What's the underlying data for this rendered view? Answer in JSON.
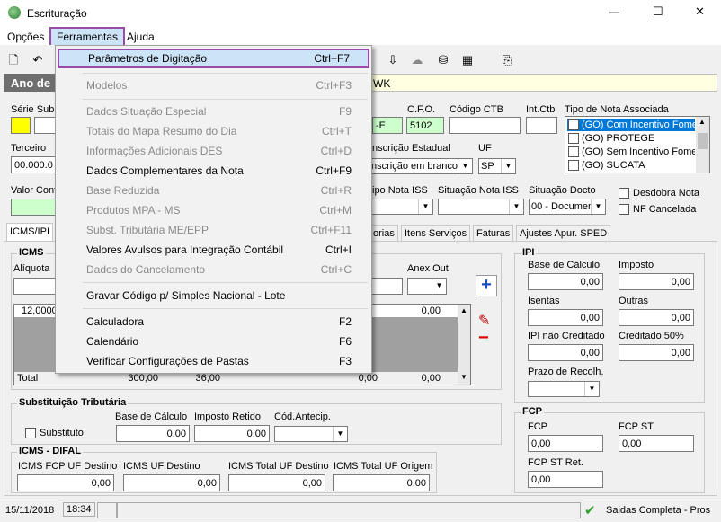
{
  "window": {
    "title": "Escrituração",
    "minimize": "—",
    "maximize": "☐",
    "close": "✕"
  },
  "menubar": {
    "items": [
      "Opções",
      "Ferramentas",
      "Ajuda"
    ]
  },
  "banner": {
    "left": "Ano de",
    "right": "WK"
  },
  "header": {
    "serie_label": "Série Sub",
    "cfo_label": "C.F.O.",
    "cfo_value": "5102",
    "cfo_prefix": "-E",
    "codigo_ctb_label": "Código CTB",
    "int_ctb_label": "Int.Ctb",
    "tipo_nota_label": "Tipo de Nota Associada",
    "tipo_nota_items": [
      "(GO) Com Incentivo Fomer",
      "(GO) PROTEGE",
      "(GO) Sem Incentivo Fomer",
      "(GO) SUCATA"
    ],
    "terceiro_label": "Terceiro",
    "terceiro_value": "00.000.0",
    "inscricao_label": "nscrição Estadual",
    "inscricao_value": "nscrição em branco",
    "uf_label": "UF",
    "uf_value": "SP",
    "valor_label": "Valor Cont",
    "tipo_iss_label": "ipo Nota ISS",
    "sit_iss_label": "Situação Nota ISS",
    "sit_docto_label": "Situação Docto",
    "sit_docto_value": "00 - Documen",
    "desdobra_label": "Desdobra Nota",
    "nf_cancelada_label": "NF Cancelada"
  },
  "tabs": [
    "ICMS/IPI",
    "orias",
    "Itens Serviços",
    "Faturas",
    "Ajustes Apur. SPED"
  ],
  "icms": {
    "title": "ICMS",
    "aliquota_label": "Alíquota",
    "anex_out_label": "Anex Out",
    "row_first": "12,0000",
    "row_right": "0,00",
    "total_label": "Total",
    "total_values": [
      "300,00",
      "36,00",
      "0,00",
      "0,00"
    ]
  },
  "st": {
    "title": "Substituição Tributária",
    "substituto_label": "Substituto",
    "base_label": "Base de Cálculo",
    "base_value": "0,00",
    "imposto_label": "Imposto Retido",
    "imposto_value": "0,00",
    "cod_label": "Cód.Antecip."
  },
  "difal": {
    "title": "ICMS - DIFAL",
    "labels": [
      "ICMS FCP UF Destino",
      "ICMS UF Destino",
      "ICMS Total UF Destino",
      "ICMS Total UF Origem"
    ],
    "values": [
      "0,00",
      "0,00",
      "0,00",
      "0,00"
    ]
  },
  "ipi": {
    "title": "IPI",
    "base_label": "Base de Cálculo",
    "base_value": "0,00",
    "imposto_label": "Imposto",
    "imposto_value": "0,00",
    "isentas_label": "Isentas",
    "isentas_value": "0,00",
    "outras_label": "Outras",
    "outras_value": "0,00",
    "nao_cred_label": "IPI não Creditado",
    "nao_cred_value": "0,00",
    "cred50_label": "Creditado 50%",
    "cred50_value": "0,00",
    "prazo_label": "Prazo de Recolh."
  },
  "fcp": {
    "title": "FCP",
    "fcp_label": "FCP",
    "fcp_value": "0,00",
    "fcp_st_label": "FCP ST",
    "fcp_st_value": "0,00",
    "fcp_st_ret_label": "FCP ST Ret.",
    "fcp_st_ret_value": "0,00"
  },
  "status": {
    "date": "15/11/2018",
    "time": "18:34",
    "right": "Saidas Completa - Pros"
  },
  "menu": {
    "items": [
      {
        "label": "Parâmetros de Digitação",
        "shortcut": "Ctrl+F7"
      },
      {
        "label": "Modelos",
        "shortcut": "Ctrl+F3"
      },
      {
        "label": "Dados Situação Especial",
        "shortcut": "F9"
      },
      {
        "label": "Totais do Mapa Resumo do Dia",
        "shortcut": "Ctrl+T"
      },
      {
        "label": "Informações Adicionais DES",
        "shortcut": "Ctrl+D"
      },
      {
        "label": "Dados Complementares da Nota",
        "shortcut": "Ctrl+F9"
      },
      {
        "label": "Base Reduzida",
        "shortcut": "Ctrl+R"
      },
      {
        "label": "Produtos MPA - MS",
        "shortcut": "Ctrl+M"
      },
      {
        "label": "Subst. Tributária ME/EPP",
        "shortcut": "Ctrl+F11"
      },
      {
        "label": "Valores Avulsos para Integração Contábil",
        "shortcut": "Ctrl+I"
      },
      {
        "label": "Dados do Cancelamento",
        "shortcut": "Ctrl+C"
      },
      {
        "label": "Gravar Código p/ Simples Nacional - Lote",
        "shortcut": ""
      },
      {
        "label": "Calculadora",
        "shortcut": "F2"
      },
      {
        "label": "Calendário",
        "shortcut": "F6"
      },
      {
        "label": "Verificar Configurações de Pastas",
        "shortcut": "F3"
      }
    ]
  }
}
